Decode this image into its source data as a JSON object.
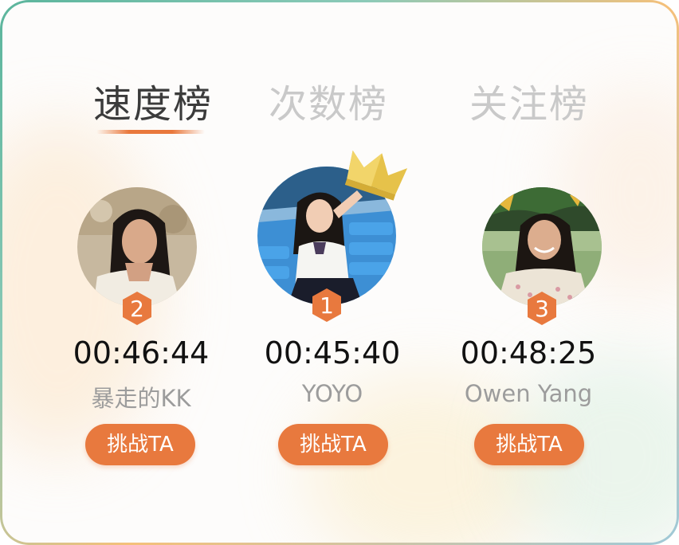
{
  "tabs": [
    {
      "label": "速度榜",
      "active": true
    },
    {
      "label": "次数榜",
      "active": false
    },
    {
      "label": "关注榜",
      "active": false
    }
  ],
  "ranking": [
    {
      "rank": "2",
      "time": "00:46:44",
      "name": "暴走的KK",
      "button": "挑战TA"
    },
    {
      "rank": "1",
      "time": "00:45:40",
      "name": "YOYO",
      "button": "挑战TA"
    },
    {
      "rank": "3",
      "time": "00:48:25",
      "name": "Owen Yang",
      "button": "挑战TA"
    }
  ],
  "colors": {
    "accent": "#e8793e",
    "active_tab": "#3b3b3b",
    "inactive_tab": "#c9c9c9",
    "crown": "#e6c24a"
  },
  "icons": {
    "crown": "crown-icon",
    "rank_badge": "hexagon-badge-icon"
  }
}
